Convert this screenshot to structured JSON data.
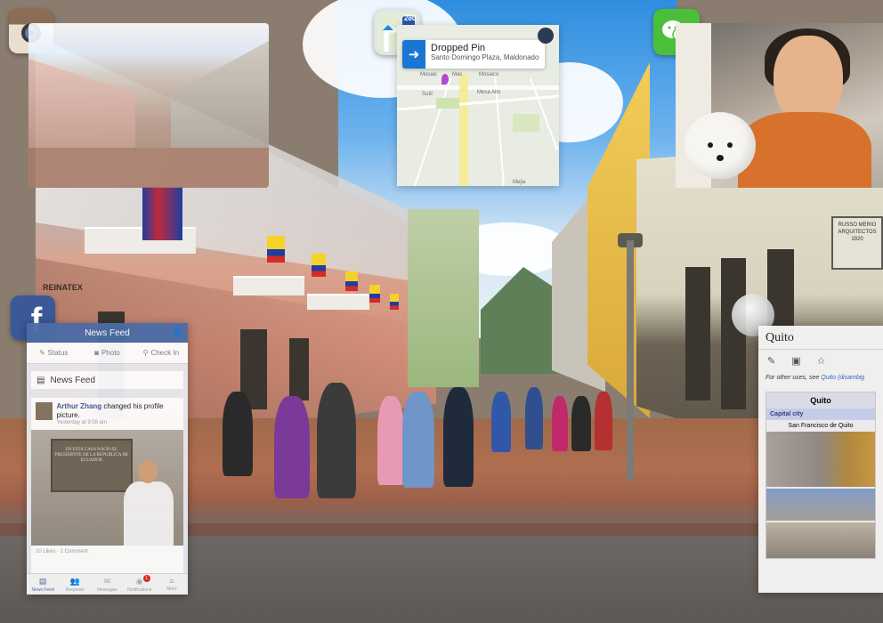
{
  "colors": {
    "facebook_blue": "#4b6ca7",
    "wechat_green": "#4cbf3a",
    "map_pin_blue": "#1976d2",
    "wiki_link": "#3366cc"
  },
  "apps": {
    "instagram": {
      "icon": "instagram-icon"
    },
    "maps": {
      "icon": "maps-app-icon",
      "highway_shield": "280"
    },
    "wechat": {
      "icon": "wechat-icon"
    },
    "facebook": {
      "icon": "facebook-icon"
    },
    "wikipedia": {
      "icon": "wikipedia-globe-icon"
    }
  },
  "map": {
    "pin_title": "Dropped Pin",
    "pin_subtitle": "Santo Domingo Plaza, Maldonado,...",
    "labels": [
      "Mosaic",
      "Mac",
      "Mosaico",
      "Mesa Alto",
      "Sutil",
      "Mejia"
    ]
  },
  "facebook": {
    "header_title": "News Feed",
    "actions": [
      "Status",
      "Photo",
      "Check In"
    ],
    "section_title": "News Feed",
    "post": {
      "author": "Arthur Zhang",
      "action": "changed his profile picture.",
      "time": "Yesterday at 9:58 am",
      "plaque_text": "EN ESTA CASA NACIO EL PRESIDENTE DE LA REPUBLICA DE ECUADOR",
      "likes": "10 Likes · 1 Comment"
    },
    "tabs": [
      {
        "label": "News Feed",
        "icon": "news-feed-icon"
      },
      {
        "label": "Requests",
        "icon": "requests-icon"
      },
      {
        "label": "Messages",
        "icon": "messages-icon"
      },
      {
        "label": "Notifications",
        "icon": "notifications-icon",
        "badge": "1"
      },
      {
        "label": "More",
        "icon": "more-icon"
      }
    ]
  },
  "wikipedia": {
    "title": "Quito",
    "note_prefix": "For other uses, see ",
    "note_link": "Quito (disambig",
    "infobox": {
      "title": "Quito",
      "row_highlight": "Capital city",
      "row_caption": "San Francisco de Quito"
    }
  },
  "scene_signs": {
    "store_sign": "RUSSO MERIO ARQUITECTOS 1920",
    "left_sign": "REINATEX"
  }
}
